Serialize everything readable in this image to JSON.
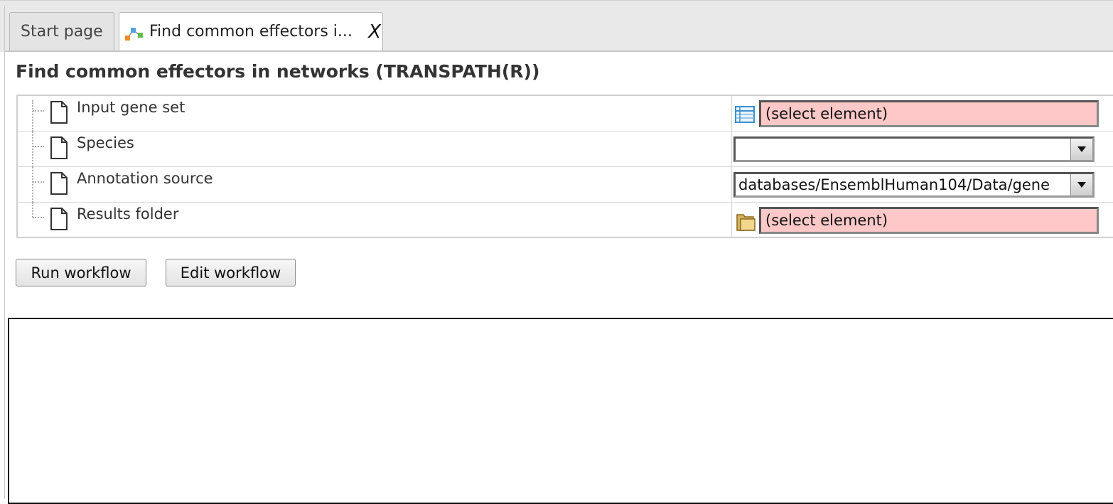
{
  "tabs": [
    {
      "label": "Start page",
      "active": false
    },
    {
      "label": "Find common effectors i...",
      "active": true,
      "close_label": "X"
    }
  ],
  "page_title": "Find common effectors in networks (TRANSPATH(R))",
  "parameters": [
    {
      "label": "Input gene set",
      "control": "element-selector",
      "value": "(select element)",
      "icon": "table-list-icon"
    },
    {
      "label": "Species",
      "control": "dropdown",
      "value": ""
    },
    {
      "label": "Annotation source",
      "control": "dropdown",
      "value": "databases/EnsemblHuman104/Data/gene"
    },
    {
      "label": "Results folder",
      "control": "element-selector",
      "value": "(select element)",
      "icon": "folder-icon"
    }
  ],
  "buttons": {
    "run": "Run workflow",
    "edit": "Edit workflow"
  },
  "colors": {
    "required_field_bg": "#ffc8c8",
    "tab_bar_bg": "#e9e9e9",
    "output_border": "#111111"
  }
}
